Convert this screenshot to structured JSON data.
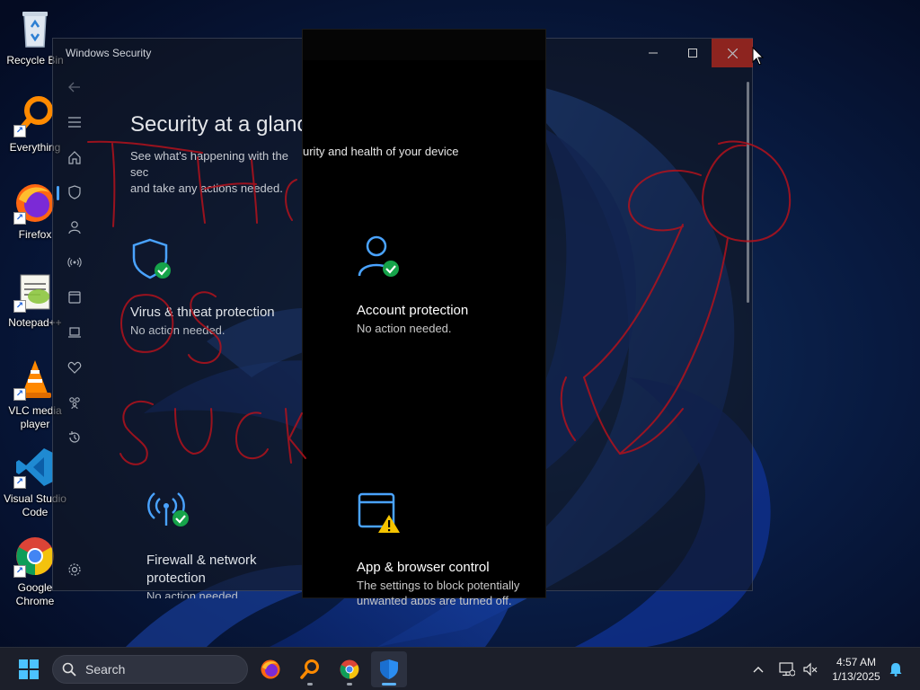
{
  "desktop": {
    "icons": [
      {
        "label": "Recycle Bin",
        "icon": "recycle-bin-icon"
      },
      {
        "label": "Everything",
        "icon": "everything-search-icon"
      },
      {
        "label": "Firefox",
        "icon": "firefox-icon"
      },
      {
        "label": "Notepad++",
        "icon": "notepad-plus-plus-icon"
      },
      {
        "label": "VLC media player",
        "icon": "vlc-icon"
      },
      {
        "label": "Visual Studio Code",
        "icon": "vscode-icon"
      },
      {
        "label": "Google Chrome",
        "icon": "chrome-icon"
      }
    ]
  },
  "window": {
    "title": "Windows Security",
    "heading": "Security at a glance",
    "subtitle": "See what's happening with the security and health of your device and take any actions needed.",
    "subtitle_overlay_part": "urity and health of your device",
    "subtitle_visible_left": "See what's happening with the sec",
    "subtitle_visible_left_line2": "and take any actions needed.",
    "cards": [
      {
        "title": "Virus & threat protection",
        "status": "No action needed.",
        "icon": "shield-check-icon"
      },
      {
        "title": "Account protection",
        "status": "No action needed.",
        "icon": "person-check-icon"
      },
      {
        "title": "Firewall & network protection",
        "status": "No action needed.",
        "icon": "wifi-check-icon"
      },
      {
        "title": "App & browser control",
        "status": "The settings to block potentially unwanted apps are turned off.",
        "icon": "app-warning-icon"
      }
    ],
    "nav": [
      "back-arrow-icon",
      "menu-icon",
      "home-icon",
      "shield-icon",
      "person-icon",
      "wifi-icon",
      "app-browser-icon",
      "laptop-icon",
      "heart-icon",
      "family-icon",
      "history-icon",
      "settings-icon"
    ]
  },
  "colors": {
    "accent": "#4aa3ff",
    "check_green": "#16a34a",
    "warning_yellow": "#f5c400",
    "close_red": "#c42b1c",
    "scribble_red": "#b3121c"
  },
  "taskbar": {
    "search_label": "Search",
    "pinned": [
      "start-icon",
      "firefox-icon",
      "everything-search-icon",
      "chrome-icon",
      "windows-security-icon"
    ],
    "time": "4:57 AM",
    "date": "1/13/2025"
  }
}
